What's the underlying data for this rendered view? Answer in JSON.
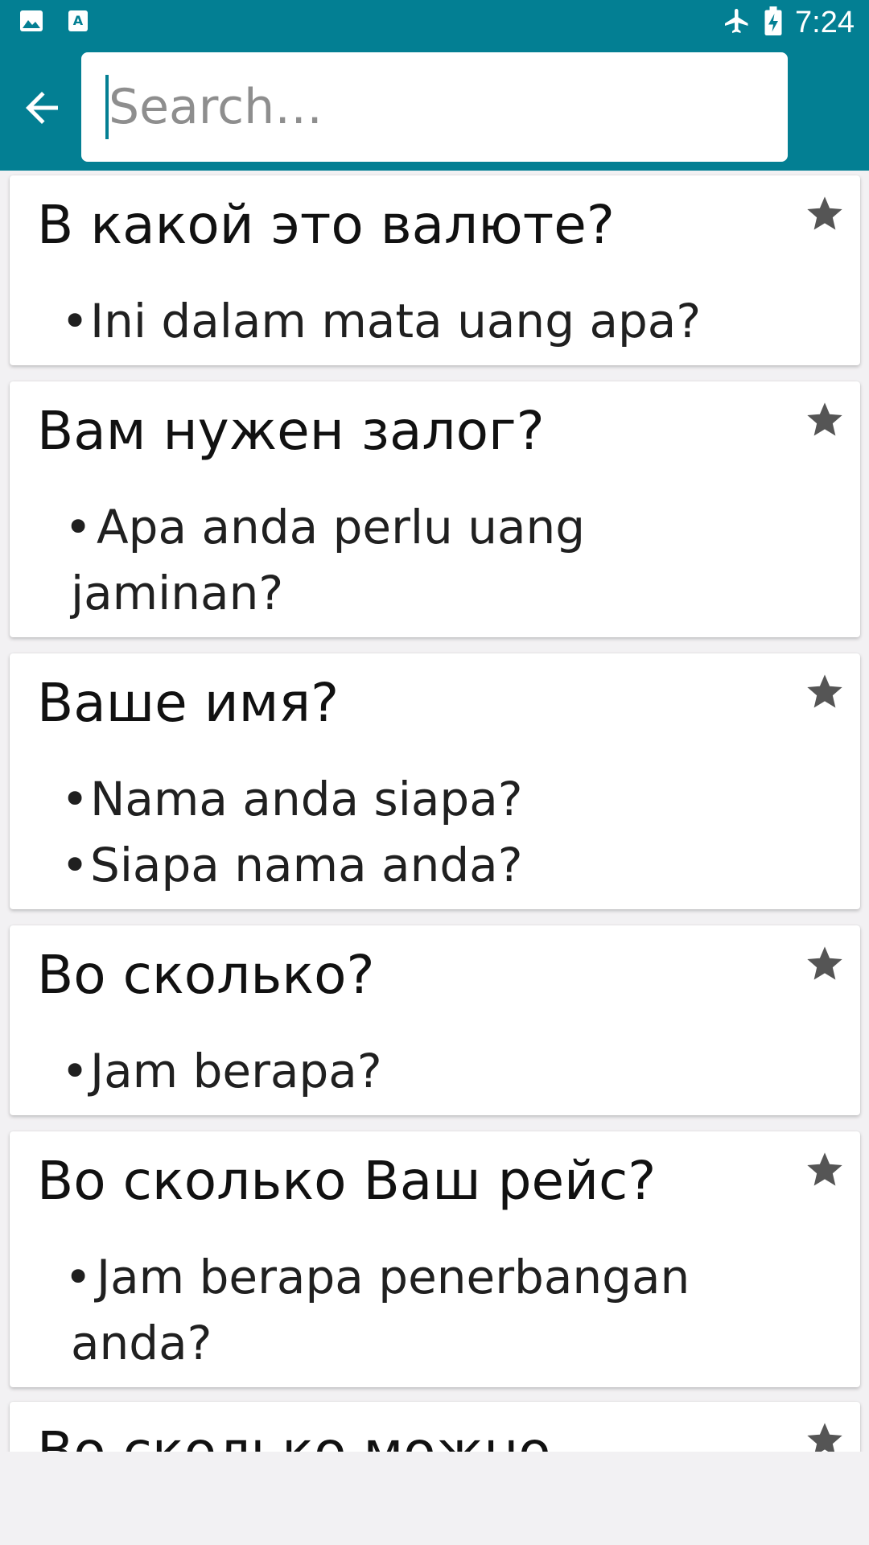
{
  "status_bar": {
    "time": "7:24",
    "left_icons": [
      "image-icon",
      "font-a-icon"
    ],
    "right_icons": [
      "airplane-icon",
      "battery-charging-icon"
    ]
  },
  "search": {
    "placeholder": "Search…",
    "value": ""
  },
  "phrases": [
    {
      "title": "В какой это валюте?",
      "translations": [
        "Ini dalam mata uang apa?"
      ]
    },
    {
      "title": "Вам нужен залог?",
      "translations": [
        "Apa anda perlu uang jaminan?"
      ]
    },
    {
      "title": "Ваше имя?",
      "translations": [
        "Nama anda siapa?",
        "Siapa nama anda?"
      ]
    },
    {
      "title": "Во сколько?",
      "translations": [
        "Jam berapa?"
      ]
    },
    {
      "title": "Во сколько Ваш рейс?",
      "translations": [
        "Jam berapa penerbangan anda?"
      ]
    },
    {
      "title": "Во сколько можно",
      "translations": []
    }
  ],
  "colors": {
    "accent": "#037f93",
    "star": "#555555",
    "background": "#f2f1f3"
  }
}
